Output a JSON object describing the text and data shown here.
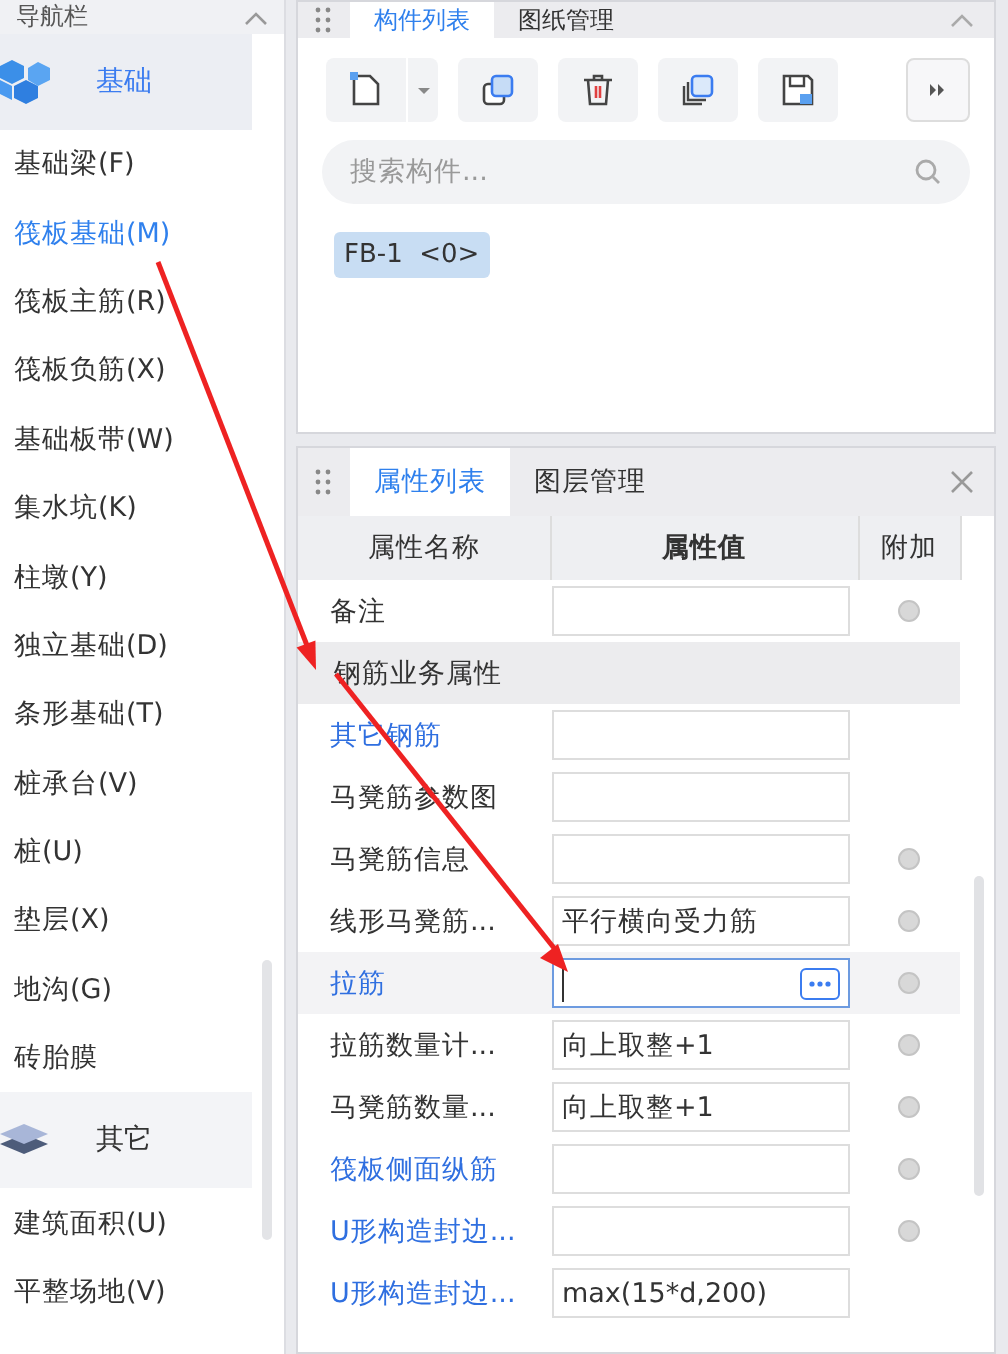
{
  "nav": {
    "title": "导航栏",
    "groups": [
      {
        "label": "基础",
        "kind": "cubes",
        "selected": true,
        "items": [
          {
            "label": "基础梁(F)",
            "selected": false
          },
          {
            "label": "筏板基础(M)",
            "selected": true
          },
          {
            "label": "筏板主筋(R)",
            "selected": false
          },
          {
            "label": "筏板负筋(X)",
            "selected": false
          },
          {
            "label": "基础板带(W)",
            "selected": false
          },
          {
            "label": "集水坑(K)",
            "selected": false
          },
          {
            "label": "柱墩(Y)",
            "selected": false
          },
          {
            "label": "独立基础(D)",
            "selected": false
          },
          {
            "label": "条形基础(T)",
            "selected": false
          },
          {
            "label": "桩承台(V)",
            "selected": false
          },
          {
            "label": "桩(U)",
            "selected": false
          },
          {
            "label": "垫层(X)",
            "selected": false
          },
          {
            "label": "地沟(G)",
            "selected": false
          },
          {
            "label": "砖胎膜",
            "selected": false
          }
        ]
      },
      {
        "label": "其它",
        "kind": "layers",
        "selected": false,
        "items": [
          {
            "label": "建筑面积(U)",
            "selected": false
          },
          {
            "label": "平整场地(V)",
            "selected": false
          }
        ]
      }
    ]
  },
  "component_panel": {
    "tabs": [
      {
        "label": "构件列表",
        "selected": true
      },
      {
        "label": "图纸管理",
        "selected": false
      }
    ],
    "search": {
      "placeholder": "搜索构件..."
    },
    "components": [
      {
        "label": "FB-1  <0>",
        "selected": true
      }
    ]
  },
  "property_panel": {
    "tabs": [
      {
        "label": "属性列表",
        "selected": true
      },
      {
        "label": "图层管理",
        "selected": false
      }
    ],
    "columns": [
      "属性名称",
      "属性值",
      "附加"
    ],
    "rows": [
      {
        "kind": "property",
        "name": "备注",
        "value": "",
        "emphasized": false,
        "attachable": true,
        "selected": false
      },
      {
        "kind": "group",
        "name": "钢筋业务属性"
      },
      {
        "kind": "property",
        "name": "其它钢筋",
        "value": "",
        "emphasized": true,
        "attachable": false,
        "selected": false
      },
      {
        "kind": "property",
        "name": "马凳筋参数图",
        "value": "",
        "emphasized": false,
        "attachable": false,
        "selected": false
      },
      {
        "kind": "property",
        "name": "马凳筋信息",
        "value": "",
        "emphasized": false,
        "attachable": true,
        "selected": false
      },
      {
        "kind": "property",
        "name": "线形马凳筋...",
        "value": "平行横向受力筋",
        "emphasized": false,
        "attachable": true,
        "selected": false
      },
      {
        "kind": "property",
        "name": "拉筋",
        "value": "",
        "emphasized": true,
        "attachable": true,
        "selected": true
      },
      {
        "kind": "property",
        "name": "拉筋数量计...",
        "value": "向上取整+1",
        "emphasized": false,
        "attachable": true,
        "selected": false
      },
      {
        "kind": "property",
        "name": "马凳筋数量...",
        "value": "向上取整+1",
        "emphasized": false,
        "attachable": true,
        "selected": false
      },
      {
        "kind": "property",
        "name": "筏板侧面纵筋",
        "value": "",
        "emphasized": true,
        "attachable": true,
        "selected": false
      },
      {
        "kind": "property",
        "name": "U形构造封边...",
        "value": "",
        "emphasized": true,
        "attachable": true,
        "selected": false
      },
      {
        "kind": "property",
        "name": "U形构造封边...",
        "value": "max(15*d,200)",
        "emphasized": true,
        "attachable": false,
        "selected": false
      }
    ]
  }
}
